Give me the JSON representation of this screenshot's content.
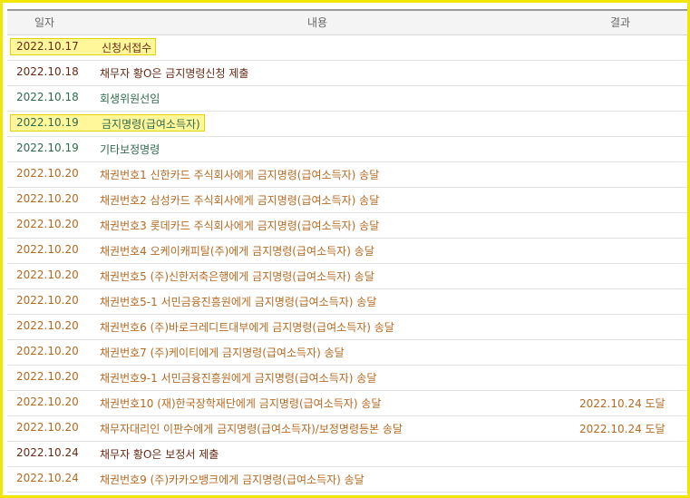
{
  "columns": {
    "date": "일자",
    "content": "내용",
    "result": "결과"
  },
  "colors": {
    "dark": "#6a2a16",
    "green": "#2f6b4f",
    "orange": "#b56a22",
    "highlight": "#fff79a"
  },
  "rows": [
    {
      "date": "2022.10.17",
      "content": "신청서접수",
      "result": "",
      "color": "dark",
      "highlighted": true
    },
    {
      "date": "2022.10.18",
      "content": "채무자 황O은 금지명령신청 제출",
      "result": "",
      "color": "dark",
      "highlighted": false
    },
    {
      "date": "2022.10.18",
      "content": "회생위원선임",
      "result": "",
      "color": "green",
      "highlighted": false
    },
    {
      "date": "2022.10.19",
      "content": "금지명령(급여소득자)",
      "result": "",
      "color": "green",
      "highlighted": true
    },
    {
      "date": "2022.10.19",
      "content": "기타보정명령",
      "result": "",
      "color": "green",
      "highlighted": false
    },
    {
      "date": "2022.10.20",
      "content": "채권번호1 신한카드 주식회사에게 금지명령(급여소득자) 송달",
      "result": "",
      "color": "orange",
      "highlighted": false
    },
    {
      "date": "2022.10.20",
      "content": "채권번호2 삼성카드 주식회사에게 금지명령(급여소득자) 송달",
      "result": "",
      "color": "orange",
      "highlighted": false
    },
    {
      "date": "2022.10.20",
      "content": "채권번호3 롯데카드 주식회사에게 금지명령(급여소득자) 송달",
      "result": "",
      "color": "orange",
      "highlighted": false
    },
    {
      "date": "2022.10.20",
      "content": "채권번호4 오케이캐피탈(주)에게 금지명령(급여소득자) 송달",
      "result": "",
      "color": "orange",
      "highlighted": false
    },
    {
      "date": "2022.10.20",
      "content": "채권번호5 (주)신한저축은행에게 금지명령(급여소득자) 송달",
      "result": "",
      "color": "orange",
      "highlighted": false
    },
    {
      "date": "2022.10.20",
      "content": "채권번호5-1 서민금융진흥원에게 금지명령(급여소득자) 송달",
      "result": "",
      "color": "orange",
      "highlighted": false
    },
    {
      "date": "2022.10.20",
      "content": "채권번호6 (주)바로크레디트대부에게 금지명령(급여소득자) 송달",
      "result": "",
      "color": "orange",
      "highlighted": false
    },
    {
      "date": "2022.10.20",
      "content": "채권번호7 (주)케이티에게 금지명령(급여소득자) 송달",
      "result": "",
      "color": "orange",
      "highlighted": false
    },
    {
      "date": "2022.10.20",
      "content": "채권번호9-1 서민금융진흥원에게 금지명령(급여소득자) 송달",
      "result": "",
      "color": "orange",
      "highlighted": false
    },
    {
      "date": "2022.10.20",
      "content": "채권번호10 (재)한국장학재단에게 금지명령(급여소득자) 송달",
      "result": "2022.10.24 도달",
      "color": "orange",
      "highlighted": false
    },
    {
      "date": "2022.10.20",
      "content": "채무자대리인 이판수에게 금지명령(급여소득자)/보정명령등본 송달",
      "result": "2022.10.24 도달",
      "color": "orange",
      "highlighted": false
    },
    {
      "date": "2022.10.24",
      "content": "채무자 황O은 보정서 제출",
      "result": "",
      "color": "dark",
      "highlighted": false
    },
    {
      "date": "2022.10.24",
      "content": "채권번호9 (주)카카오뱅크에게 금지명령(급여소득자) 송달",
      "result": "",
      "color": "orange",
      "highlighted": false
    }
  ]
}
